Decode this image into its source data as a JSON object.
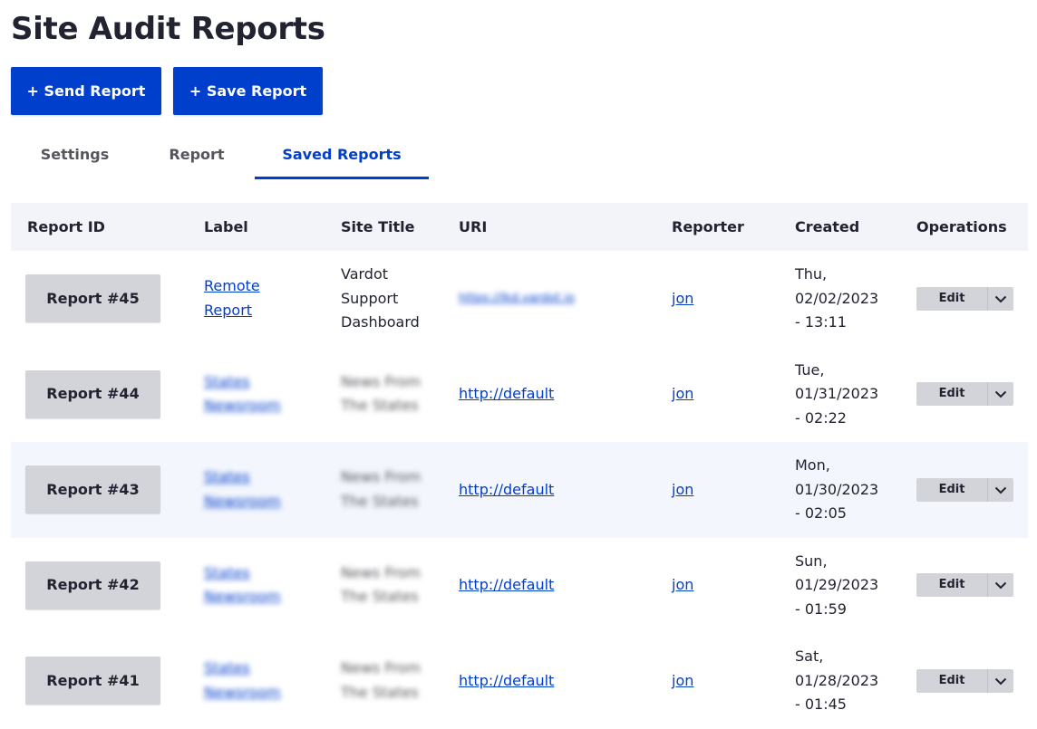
{
  "page": {
    "title": "Site Audit Reports"
  },
  "actions": {
    "send_label": "+ Send Report",
    "save_label": "+ Save Report"
  },
  "tabs": [
    {
      "label": "Settings"
    },
    {
      "label": "Report"
    },
    {
      "label": "Saved Reports"
    }
  ],
  "table": {
    "headers": {
      "id": "Report ID",
      "label": "Label",
      "site_title": "Site Title",
      "uri": "URI",
      "reporter": "Reporter",
      "created": "Created",
      "operations": "Operations"
    },
    "rows": [
      {
        "id": "Report #45",
        "label": [
          "Remote",
          "Report"
        ],
        "site_title": [
          "Vardot",
          "Support",
          "Dashboard"
        ],
        "uri": "https://lkd.vardot.io",
        "reporter": "jon",
        "created": [
          "Thu,",
          "02/02/2023",
          "- 13:11"
        ],
        "edit": "Edit"
      },
      {
        "id": "Report #44",
        "label": [
          "States",
          "Newsroom"
        ],
        "site_title": [
          "News From",
          "The States"
        ],
        "uri": "http://default",
        "reporter": "jon",
        "created": [
          "Tue,",
          "01/31/2023",
          "- 02:22"
        ],
        "edit": "Edit"
      },
      {
        "id": "Report #43",
        "label": [
          "States",
          "Newsroom"
        ],
        "site_title": [
          "News From",
          "The States"
        ],
        "uri": "http://default",
        "reporter": "jon",
        "created": [
          "Mon,",
          "01/30/2023",
          "- 02:05"
        ],
        "edit": "Edit"
      },
      {
        "id": "Report #42",
        "label": [
          "States",
          "Newsroom"
        ],
        "site_title": [
          "News From",
          "The States"
        ],
        "uri": "http://default",
        "reporter": "jon",
        "created": [
          "Sun,",
          "01/29/2023",
          "- 01:59"
        ],
        "edit": "Edit"
      },
      {
        "id": "Report #41",
        "label": [
          "States",
          "Newsroom"
        ],
        "site_title": [
          "News From",
          "The States"
        ],
        "uri": "http://default",
        "reporter": "jon",
        "created": [
          "Sat,",
          "01/28/2023",
          "- 01:45"
        ],
        "edit": "Edit"
      }
    ]
  },
  "colors": {
    "primary": "#003ecc",
    "stripe": "#f3f6fd",
    "header_bg": "#f3f4f9",
    "button_gray": "#d3d4d9"
  }
}
